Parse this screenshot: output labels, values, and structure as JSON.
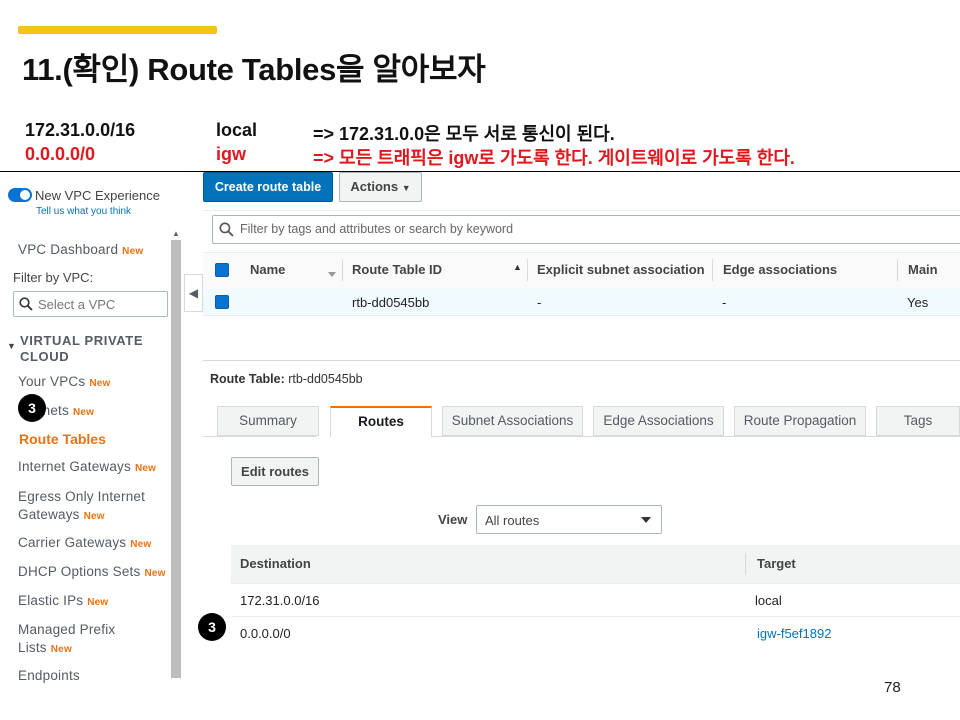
{
  "slide": {
    "title": "11.(확인) Route Tables을 알아보자",
    "notes": [
      {
        "cidr": "172.31.0.0/16",
        "target": "local",
        "desc": "=> 172.31.0.0은 모두 서로 통신이 된다."
      },
      {
        "cidr": "0.0.0.0/0",
        "target": "igw",
        "desc": "=> 모든 트래픽은 igw로 가도록 한다. 게이트웨이로 가도록 한다."
      }
    ],
    "page_number": "78",
    "accent_color": "#f2c318",
    "note_red": "#e0181e"
  },
  "sidebar": {
    "new_vpc_label": "New VPC Experience",
    "tell_us": "Tell us what you think",
    "dashboard": "VPC Dashboard",
    "new_badge": "New",
    "filter_label": "Filter by VPC:",
    "select_placeholder": "Select a VPC",
    "section_title": "VIRTUAL PRIVATE CLOUD",
    "items": {
      "your_vpcs": "Your VPCs",
      "subnets": "Subnets",
      "route_tables": "Route Tables",
      "igw": "Internet Gateways",
      "egress_1": "Egress Only Internet",
      "egress_2": "Gateways",
      "carrier": "Carrier Gateways",
      "dhcp": "DHCP Options Sets",
      "eips": "Elastic IPs",
      "prefix_1": "Managed Prefix",
      "prefix_2": "Lists",
      "endpoints": "Endpoints"
    }
  },
  "toolbar": {
    "create": "Create route table",
    "actions": "Actions"
  },
  "search": {
    "placeholder": "Filter by tags and attributes or search by keyword"
  },
  "table": {
    "headers": {
      "name": "Name",
      "id": "Route Table ID",
      "explicit": "Explicit subnet association",
      "edge": "Edge associations",
      "main": "Main"
    },
    "row": {
      "name": "",
      "id": "rtb-dd0545bb",
      "explicit": "-",
      "edge": "-",
      "main": "Yes"
    }
  },
  "detail": {
    "label": "Route Table:",
    "value": "rtb-dd0545bb",
    "tabs": [
      "Summary",
      "Routes",
      "Subnet Associations",
      "Edge Associations",
      "Route Propagation",
      "Tags"
    ],
    "edit_routes": "Edit routes",
    "view_label": "View",
    "view_value": "All routes",
    "routes_headers": {
      "destination": "Destination",
      "target": "Target"
    },
    "routes": [
      {
        "destination": "172.31.0.0/16",
        "target": "local"
      },
      {
        "destination": "0.0.0.0/0",
        "target": "igw-f5ef1892"
      }
    ]
  },
  "markers": {
    "sidebar": "3",
    "route": "3"
  }
}
